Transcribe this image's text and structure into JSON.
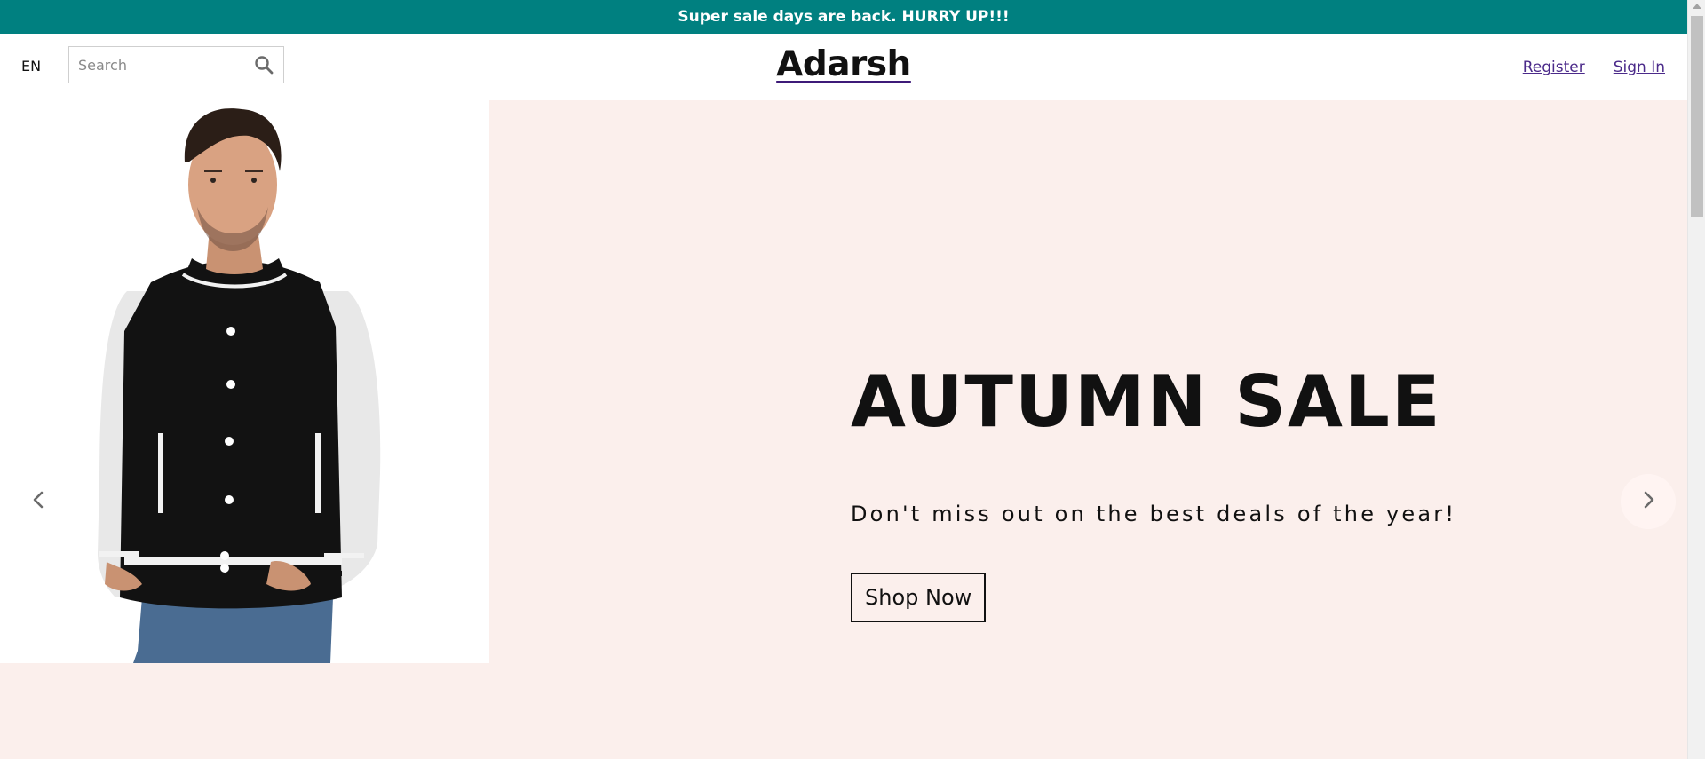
{
  "announcement": "Super sale days are back. HURRY UP!!!",
  "header": {
    "language": "EN",
    "search_placeholder": "Search",
    "logo": "Adarsh",
    "register_label": "Register",
    "signin_label": "Sign In"
  },
  "hero": {
    "title": "AUTUMN SALE",
    "subtitle": "Don't miss out on the best deals of the year!",
    "button_label": "Shop Now",
    "image_icon": "product-jacket-image"
  },
  "slider": {
    "prev_icon": "chevron-left-icon",
    "next_icon": "chevron-right-icon"
  },
  "colors": {
    "announcement_bg": "#008080",
    "hero_bg": "#fbefec",
    "link": "#4b2a8a"
  }
}
